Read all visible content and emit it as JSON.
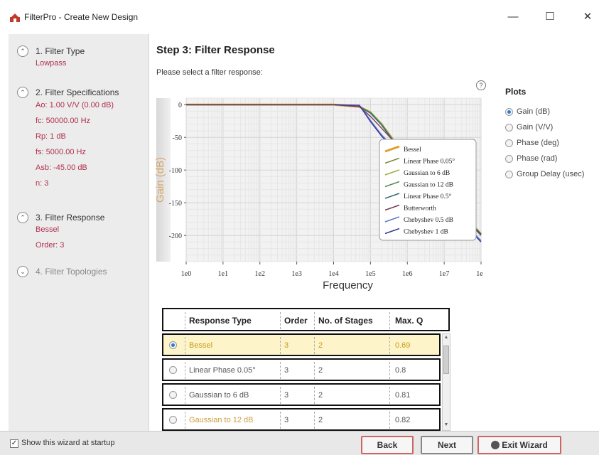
{
  "window": {
    "title": "FilterPro - Create New Design",
    "minimize": "—",
    "maximize": "☐",
    "close": "✕"
  },
  "sidebar": {
    "steps": [
      {
        "label": "1. Filter Type",
        "expanded": true,
        "details": [
          "Lowpass"
        ]
      },
      {
        "label": "2. Filter Specifications",
        "expanded": true,
        "details": [
          "Ao: 1.00 V/V (0.00 dB)",
          "fc: 50000.00 Hz",
          "Rp: 1 dB",
          "fs: 5000.00 Hz",
          "Asb: -45.00 dB",
          "n: 3"
        ]
      },
      {
        "label": "3. Filter Response",
        "expanded": true,
        "details": [
          "Bessel",
          "Order: 3"
        ]
      },
      {
        "label": "4. Filter Topologies",
        "expanded": false,
        "details": []
      }
    ],
    "expand_glyph": "⌃",
    "collapse_glyph": "⌄"
  },
  "main": {
    "title": "Step 3: Filter Response",
    "prompt": "Please select a filter response:",
    "help": "?"
  },
  "chart_data": {
    "type": "line",
    "xlabel": "Frequency",
    "ylabel": "Gain (dB)",
    "x_scale": "log",
    "xlim": [
      1,
      100000000
    ],
    "ylim": [
      -240,
      10
    ],
    "x_tick_labels": [
      "1e0",
      "1e1",
      "1e2",
      "1e3",
      "1e4",
      "1e5",
      "1e6",
      "1e7",
      "1e"
    ],
    "y_tick_labels": [
      "0",
      "-50",
      "-100",
      "-150",
      "-200"
    ],
    "y_ticks": [
      0,
      -50,
      -100,
      -150,
      -200
    ],
    "grid": true,
    "legend_placement": "top-right",
    "x": [
      1,
      10,
      100,
      1000,
      10000,
      50000,
      100000,
      200000,
      500000,
      1000000,
      10000000,
      100000000
    ],
    "series": [
      {
        "name": "Bessel",
        "color": "#e0a030",
        "values": [
          0,
          0,
          0,
          0,
          0,
          -3,
          -12,
          -30,
          -60,
          -78,
          -138,
          -198
        ]
      },
      {
        "name": "Linear Phase 0.05°",
        "color": "#7a8a3a",
        "values": [
          0,
          0,
          0,
          0,
          0,
          -3,
          -12,
          -30,
          -60,
          -79,
          -139,
          -199
        ]
      },
      {
        "name": "Gaussian to 6 dB",
        "color": "#9ab040",
        "values": [
          0,
          0,
          0,
          0,
          0,
          -3,
          -11,
          -29,
          -59,
          -77,
          -137,
          -197
        ]
      },
      {
        "name": "Gaussian to 12 dB",
        "color": "#5a8a5a",
        "values": [
          0,
          0,
          0,
          0,
          0,
          -3,
          -12,
          -30,
          -61,
          -80,
          -140,
          -200
        ]
      },
      {
        "name": "Linear Phase 0.5°",
        "color": "#3a6a7a",
        "values": [
          0,
          0,
          0,
          0,
          0,
          -3,
          -13,
          -31,
          -62,
          -80,
          -140,
          -200
        ]
      },
      {
        "name": "Butterworth",
        "color": "#7a3a5a",
        "values": [
          0,
          0,
          0,
          0,
          0,
          -3,
          -18,
          -36,
          -60,
          -78,
          -138,
          -198
        ]
      },
      {
        "name": "Chebyshev 0.5 dB",
        "color": "#5a7ad0",
        "values": [
          0,
          0,
          0,
          0,
          0,
          -1,
          -24,
          -46,
          -70,
          -88,
          -148,
          -208
        ]
      },
      {
        "name": "Chebyshev 1 dB",
        "color": "#3a3a9a",
        "values": [
          0,
          0,
          0,
          0,
          0,
          -1,
          -26,
          -48,
          -72,
          -90,
          -150,
          -210
        ]
      }
    ]
  },
  "plots": {
    "title": "Plots",
    "options": [
      {
        "label": "Gain (dB)",
        "selected": true
      },
      {
        "label": "Gain (V/V)",
        "selected": false
      },
      {
        "label": "Phase (deg)",
        "selected": false
      },
      {
        "label": "Phase (rad)",
        "selected": false
      },
      {
        "label": "Group Delay (usec)",
        "selected": false
      }
    ]
  },
  "table": {
    "headers": [
      "Response Type",
      "Order",
      "No. of Stages",
      "Max. Q"
    ],
    "rows": [
      {
        "type": "Bessel",
        "order": "3",
        "stages": "2",
        "maxq": "0.69",
        "selected": true
      },
      {
        "type": "Linear Phase 0.05°",
        "order": "3",
        "stages": "2",
        "maxq": "0.8",
        "selected": false
      },
      {
        "type": "Gaussian to 6 dB",
        "order": "3",
        "stages": "2",
        "maxq": "0.81",
        "selected": false
      },
      {
        "type": "Gaussian to 12 dB",
        "order": "3",
        "stages": "2",
        "maxq": "0.82",
        "selected": false
      }
    ]
  },
  "footer": {
    "show_wizard_label": "Show this wizard at startup",
    "show_wizard_checked": true,
    "back": "Back",
    "next": "Next",
    "exit": "Exit Wizard"
  }
}
